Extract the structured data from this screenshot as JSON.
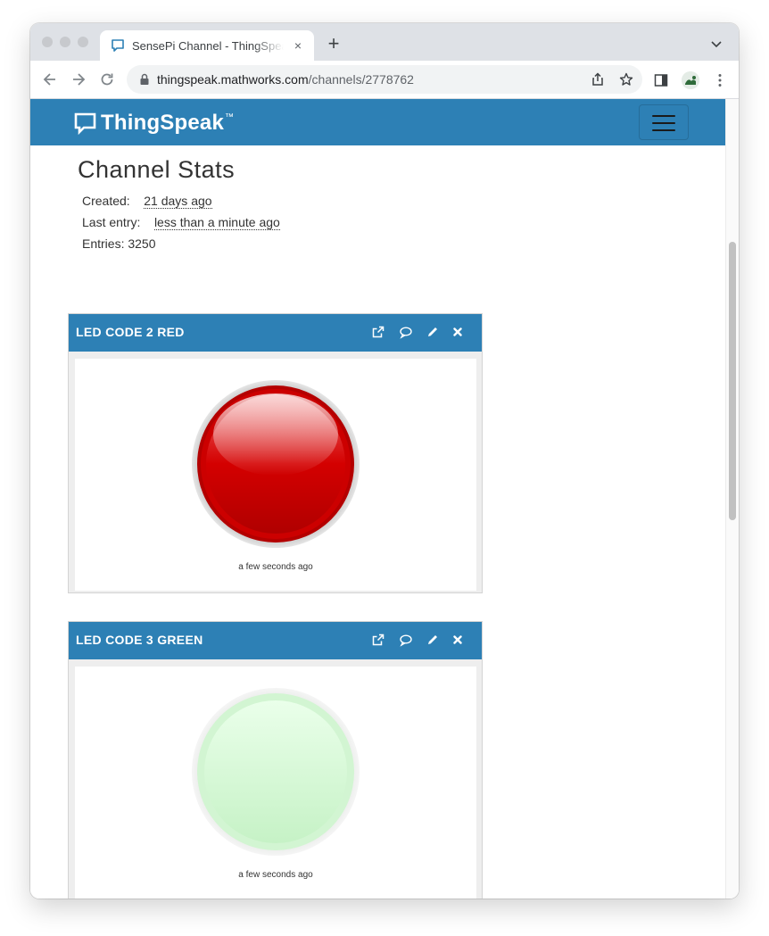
{
  "browser": {
    "tab_title": "SensePi Channel - ThingSpeak",
    "url_host": "thingspeak.mathworks.com",
    "url_path": "/channels/2778762",
    "new_tab_symbol": "+",
    "close_symbol": "×"
  },
  "header": {
    "logo_text": "ThingSpeak",
    "logo_tm": "™"
  },
  "stats": {
    "title": "Channel Stats",
    "created_label": "Created:",
    "created_value": "21 days ago",
    "last_entry_label": "Last entry:",
    "last_entry_value": "less than a minute ago",
    "entries_text": "Entries: 3250"
  },
  "widgets": [
    {
      "title": "LED CODE 2 RED",
      "state": "on",
      "color": "#d40000",
      "timestamp": "a few seconds ago"
    },
    {
      "title": "LED CODE 3 GREEN",
      "state": "off",
      "color": "#c8f5c8",
      "timestamp": "a few seconds ago"
    }
  ],
  "colors": {
    "brand": "#2d80b5",
    "led_red": "#d40000",
    "led_green_off": "#c8f5c8"
  }
}
